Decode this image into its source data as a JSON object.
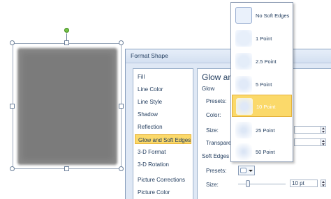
{
  "dialog": {
    "title": "Format Shape",
    "nav_items": [
      "Fill",
      "Line Color",
      "Line Style",
      "Shadow",
      "Reflection",
      "Glow and Soft Edges",
      "3-D Format",
      "3-D Rotation",
      "Picture Corrections",
      "Picture Color"
    ],
    "active_nav_index": 5,
    "panel_heading": "Glow and",
    "glow_section": "Glow",
    "glow": {
      "presets_label": "Presets:",
      "color_label": "Color:",
      "size_label": "Size:",
      "transparency_label": "Transpare"
    },
    "soft_edges_section": "Soft Edges",
    "soft_edges": {
      "presets_label": "Presets:",
      "size_label": "Size:",
      "size_value": "10 pt",
      "slider_fraction": 0.2
    }
  },
  "soft_edges_menu": {
    "items": [
      "No Soft Edges",
      "1 Point",
      "2.5 Point",
      "5 Point",
      "10 Point",
      "25 Point",
      "50 Point"
    ],
    "selected_index": 4
  },
  "colors": {
    "highlight": "#fbd96a",
    "dialog_bg": "#dfe8f5",
    "rotation_handle": "#74c247",
    "shape_fill": "#7b7b7b"
  }
}
